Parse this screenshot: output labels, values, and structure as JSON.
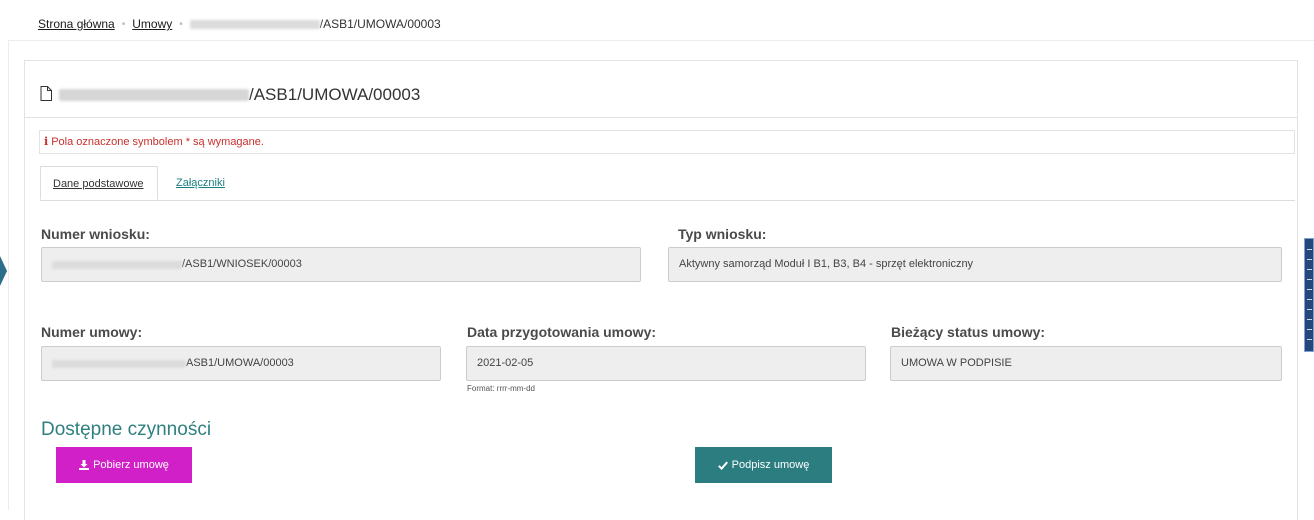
{
  "breadcrumb": {
    "home": "Strona główna",
    "contracts": "Umowy",
    "current_suffix": "/ASB1/UMOWA/00003"
  },
  "panel": {
    "title_suffix": "/ASB1/UMOWA/00003"
  },
  "notice": {
    "text": "Pola oznaczone symbolem * są wymagane.",
    "color": "#c9302c"
  },
  "tabs": [
    {
      "label": "Dane podstawowe",
      "active": true
    },
    {
      "label": "Załączniki",
      "active": false
    }
  ],
  "fields": {
    "application_number": {
      "label": "Numer wniosku:",
      "value_suffix": "/ASB1/WNIOSEK/00003"
    },
    "application_type": {
      "label": "Typ wniosku:",
      "value": "Aktywny samorząd Moduł I B1, B3, B4 - sprzęt elektroniczny"
    },
    "contract_number": {
      "label": "Numer umowy:",
      "value_suffix": "ASB1/UMOWA/00003"
    },
    "contract_date": {
      "label": "Data przygotowania umowy:",
      "value": "2021-02-05",
      "hint": "Format: rrrr-mm-dd"
    },
    "contract_status": {
      "label": "Bieżący status umowy:",
      "value": "UMOWA W PODPISIE"
    }
  },
  "actions": {
    "title": "Dostępne czynności",
    "download_label": "Pobierz umowę",
    "sign_label": "Podpisz umowę",
    "download_color": "#d120c8",
    "sign_color": "#2b7d80"
  },
  "icons": {
    "document": "document-icon",
    "info": "info-icon",
    "download": "download-icon",
    "check": "check-icon"
  }
}
